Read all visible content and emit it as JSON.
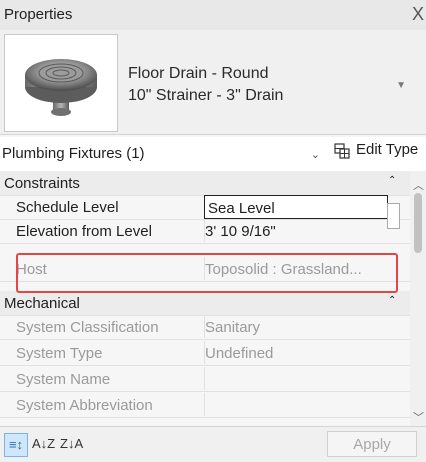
{
  "window": {
    "title": "Properties",
    "close_glyph": "X"
  },
  "type_selector": {
    "thumbnail_icon": "floor-drain-icon",
    "name_line1": "Floor Drain - Round",
    "name_line2": "10\" Strainer - 3\" Drain",
    "dropdown_icon": "chevron-down-icon"
  },
  "category_filter": {
    "selected": "Plumbing Fixtures (1)",
    "edit_type_label": "Edit Type"
  },
  "groups": {
    "constraints": "Constraints",
    "mechanical": "Mechanical"
  },
  "properties": {
    "schedule_level": {
      "name": "Schedule Level",
      "value": "Sea Level"
    },
    "elevation_from_level": {
      "name": "Elevation from Level",
      "value": "3'  10 9/16\""
    },
    "host": {
      "name": "Host",
      "value": "Toposolid : Grassland..."
    },
    "system_classification": {
      "name": "System Classification",
      "value": "Sanitary"
    },
    "system_type": {
      "name": "System Type",
      "value": "Undefined"
    },
    "system_name": {
      "name": "System Name",
      "value": ""
    },
    "system_abbreviation": {
      "name": "System Abbreviation",
      "value": ""
    }
  },
  "bottom": {
    "sort_categorized_glyph": "≡↕",
    "sort_az_glyph": "A↓Z",
    "sort_za_glyph": "Z↓A",
    "apply_label": "Apply"
  },
  "colors": {
    "highlight": "#e04848",
    "active_sort": "#cfe6fb",
    "disabled_text": "#9a9a9a"
  }
}
